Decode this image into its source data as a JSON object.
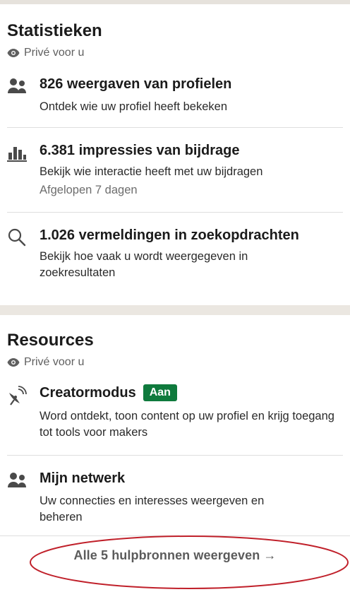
{
  "statistics": {
    "title": "Statistieken",
    "privacy": "Privé voor u",
    "items": [
      {
        "icon": "people-icon",
        "title": "826 weergaven van profielen",
        "description": "Ontdek wie uw profiel heeft bekeken"
      },
      {
        "icon": "bar-chart-icon",
        "title": "6.381 impressies van bijdrage",
        "description": "Bekijk wie interactie heeft met uw bijdragen",
        "subtext": "Afgelopen 7 dagen"
      },
      {
        "icon": "search-icon",
        "title": "1.026 vermeldingen in zoekopdrachten",
        "description": "Bekijk hoe vaak u wordt weergegeven in zoekresultaten"
      }
    ]
  },
  "resources": {
    "title": "Resources",
    "privacy": "Privé voor u",
    "items": [
      {
        "icon": "satellite-dish-icon",
        "title": "Creatormodus",
        "badge": "Aan",
        "description": "Word ontdekt, toon content op uw profiel en krijg toegang tot tools voor makers"
      },
      {
        "icon": "people-icon",
        "title": "Mijn netwerk",
        "description": "Uw connecties en interesses weergeven en beheren"
      }
    ],
    "show_all": "Alle 5 hulpbronnen weergeven →"
  },
  "colors": {
    "badge_green": "#0f7a3d",
    "annotation_red": "#c0202a",
    "divider": "#ebe7e1"
  }
}
